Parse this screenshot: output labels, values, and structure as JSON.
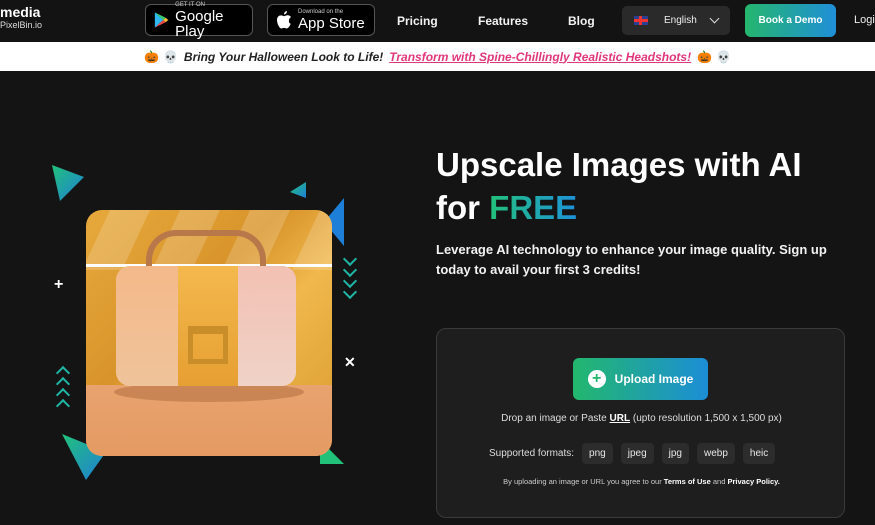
{
  "nav": {
    "logo_line1": "media",
    "logo_line2": "PixelBin.io",
    "google_play_small": "GET IT ON",
    "google_play_big": "Google Play",
    "app_store_small": "Download on the",
    "app_store_big": "App Store",
    "links": [
      "Pricing",
      "Features",
      "Blog"
    ],
    "language": "English",
    "book_demo": "Book a Demo",
    "login": "Login"
  },
  "banner": {
    "text": "Bring Your Halloween Look to Life!",
    "link": "Transform with Spine-Chillingly Realistic Headshots!"
  },
  "hero": {
    "title_line1": "Upscale Images with AI",
    "title_for": "for",
    "title_free": "FREE",
    "subtitle": "Leverage AI technology to enhance your image quality. Sign up today to avail your first 3 credits!"
  },
  "upload_card": {
    "button_label": "Upload Image",
    "drop_prefix": "Drop an image or Paste",
    "drop_url": "URL",
    "drop_suffix": "(upto resolution 1,500 x 1,500 px)",
    "formats_label": "Supported formats:",
    "formats": [
      "png",
      "jpeg",
      "jpg",
      "webp",
      "heic"
    ],
    "terms_prefix": "By uploading an image or URL you agree to our",
    "terms_link": "Terms of Use",
    "terms_and": "and",
    "privacy_link": "Privacy Policy."
  },
  "colors": {
    "accent_green": "#23b76d",
    "accent_blue": "#1c8ed6",
    "banner_link": "#e0377c",
    "background": "#141414"
  }
}
